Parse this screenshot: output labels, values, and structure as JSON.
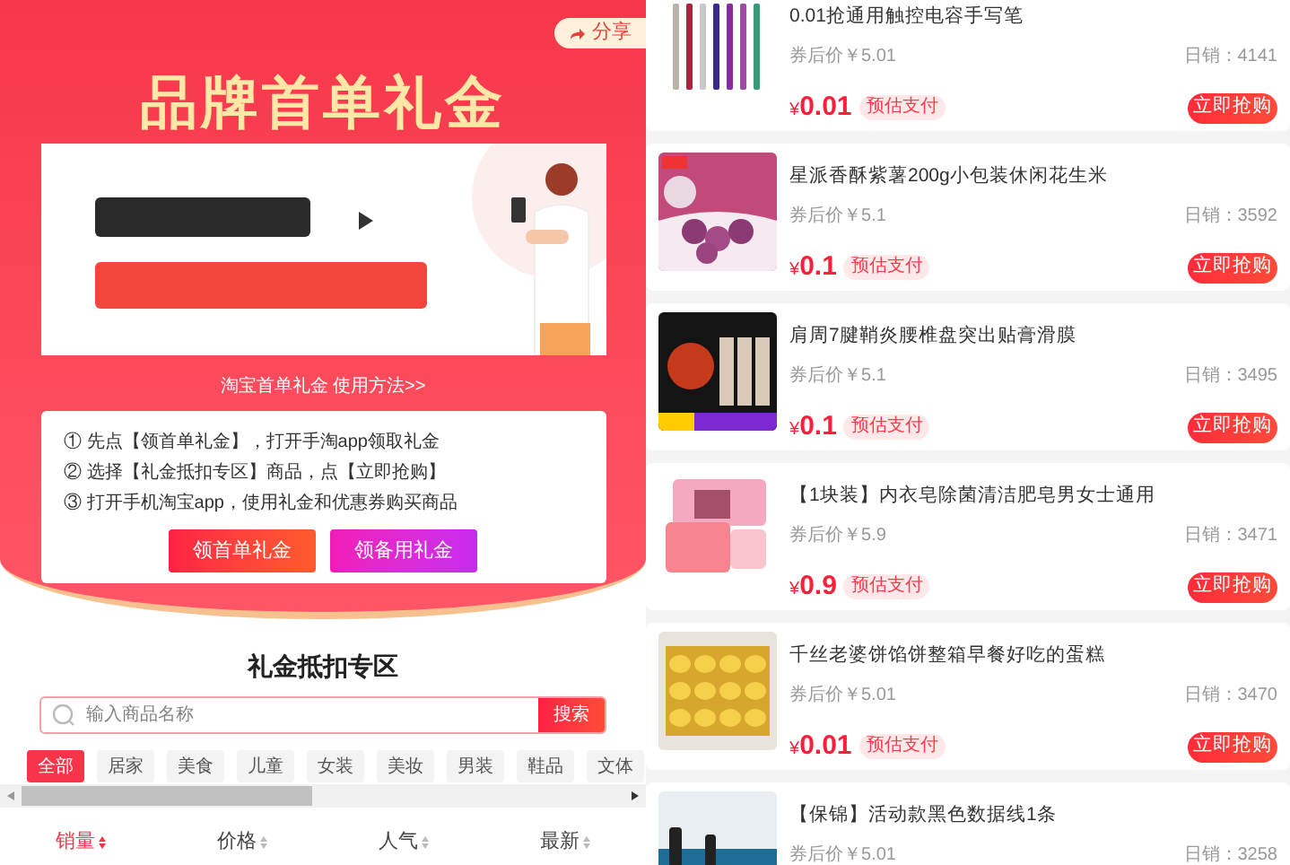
{
  "share_button": {
    "label": "分享"
  },
  "banner": {
    "title": "品牌首单礼金",
    "guide_link": "淘宝首单礼金 使用方法>>"
  },
  "steps": [
    "① 先点【领首单礼金】，打开手淘app领取礼金",
    "② 选择【礼金抵扣专区】商品，点【立即抢购】",
    "③ 打开手机淘宝app，使用礼金和优惠券购买商品"
  ],
  "actions": [
    {
      "label": "领首单礼金",
      "kind": "primary"
    },
    {
      "label": "领备用礼金",
      "kind": "secondary"
    }
  ],
  "section_title": "礼金抵扣专区",
  "search": {
    "placeholder": "输入商品名称",
    "button": "搜索"
  },
  "categories": [
    {
      "label": "全部",
      "selected": true
    },
    {
      "label": "居家",
      "selected": false
    },
    {
      "label": "美食",
      "selected": false
    },
    {
      "label": "儿童",
      "selected": false
    },
    {
      "label": "女装",
      "selected": false
    },
    {
      "label": "美妆",
      "selected": false
    },
    {
      "label": "男装",
      "selected": false
    },
    {
      "label": "鞋品",
      "selected": false
    },
    {
      "label": "文体",
      "selected": false
    }
  ],
  "sort": [
    {
      "label": "销量",
      "selected": true
    },
    {
      "label": "价格",
      "selected": false
    },
    {
      "label": "人气",
      "selected": false
    },
    {
      "label": "最新",
      "selected": false
    }
  ],
  "products": [
    {
      "title": "0.01抢通用触控电容手写笔",
      "coupon_price": "券后价￥5.01",
      "sales": "日销：4141",
      "currency": "¥",
      "price": "0.01",
      "tag": "预估支付",
      "button": "立即抢购"
    },
    {
      "title": "星派香酥紫薯200g小包装休闲花生米",
      "coupon_price": "券后价￥5.1",
      "sales": "日销：3592",
      "currency": "¥",
      "price": "0.1",
      "tag": "预估支付",
      "button": "立即抢购"
    },
    {
      "title": "肩周7腱鞘炎腰椎盘突出贴膏滑膜",
      "coupon_price": "券后价￥5.1",
      "sales": "日销：3495",
      "currency": "¥",
      "price": "0.1",
      "tag": "预估支付",
      "button": "立即抢购"
    },
    {
      "title": "【1块装】内衣皂除菌清洁肥皂男女士通用",
      "coupon_price": "券后价￥5.9",
      "sales": "日销：3471",
      "currency": "¥",
      "price": "0.9",
      "tag": "预估支付",
      "button": "立即抢购"
    },
    {
      "title": "千丝老婆饼馅饼整箱早餐好吃的蛋糕",
      "coupon_price": "券后价￥5.01",
      "sales": "日销：3470",
      "currency": "¥",
      "price": "0.01",
      "tag": "预估支付",
      "button": "立即抢购"
    },
    {
      "title": "【保锦】活动款黑色数据线1条",
      "coupon_price": "券后价￥5.01",
      "sales": "日销：3258"
    }
  ]
}
